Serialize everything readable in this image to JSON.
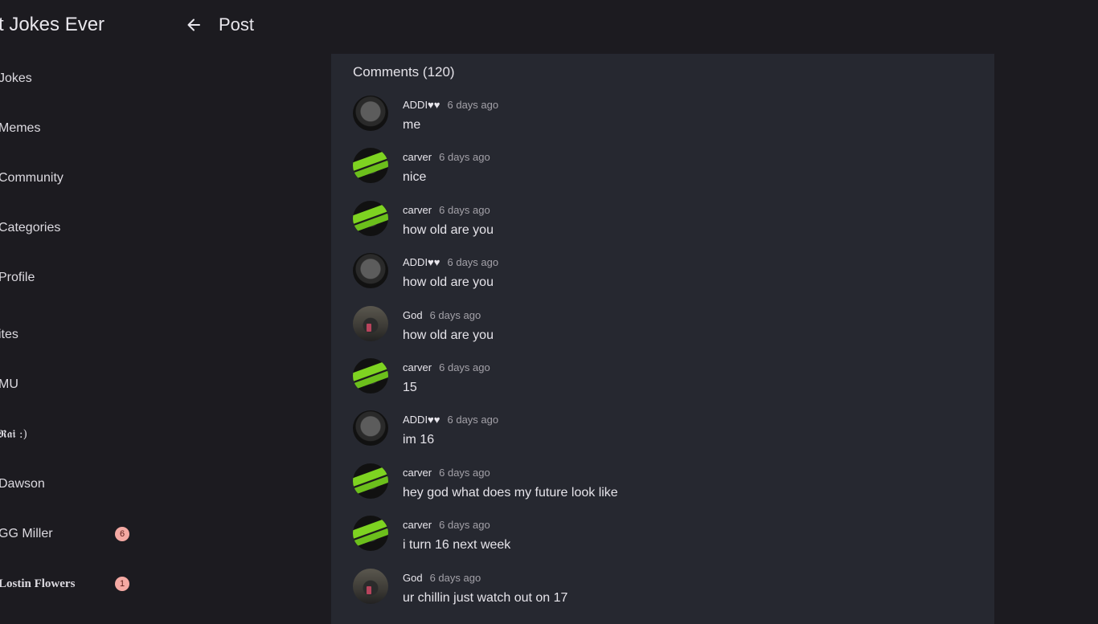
{
  "app": {
    "title": "rst Jokes Ever"
  },
  "sidebar": {
    "items": [
      {
        "label": "Jokes",
        "badge": null
      },
      {
        "label": "Memes",
        "badge": null
      },
      {
        "label": "Community",
        "badge": null
      },
      {
        "label": "Categories",
        "badge": null
      },
      {
        "label": "Profile",
        "badge": null
      },
      {
        "label": "ites",
        "badge": null
      },
      {
        "label": "MU",
        "badge": null
      },
      {
        "label": "𝕽𝖆𝖎 :)",
        "badge": null
      },
      {
        "label": "Dawson",
        "badge": null
      },
      {
        "label": "GG Miller",
        "badge": "6"
      },
      {
        "label": "Lostin Flowers",
        "badge": "1"
      }
    ]
  },
  "header": {
    "back_icon": "arrow-left-icon",
    "title": "Post"
  },
  "comments": {
    "heading": "Comments (120)",
    "list": [
      {
        "author": "ADDI♥♥",
        "time": "6 days ago",
        "text": "me",
        "avatar": "dark"
      },
      {
        "author": "carver",
        "time": "6 days ago",
        "text": "nice",
        "avatar": "green"
      },
      {
        "author": "carver",
        "time": "6 days ago",
        "text": "how old are you",
        "avatar": "green"
      },
      {
        "author": "ADDI♥♥",
        "time": "6 days ago",
        "text": "how old are you",
        "avatar": "dark"
      },
      {
        "author": "God",
        "time": "6 days ago",
        "text": "how old are you",
        "avatar": "god"
      },
      {
        "author": "carver",
        "time": "6 days ago",
        "text": "15",
        "avatar": "green"
      },
      {
        "author": "ADDI♥♥",
        "time": "6 days ago",
        "text": "im 16",
        "avatar": "dark"
      },
      {
        "author": "carver",
        "time": "6 days ago",
        "text": "hey god what does my future look like",
        "avatar": "green"
      },
      {
        "author": "carver",
        "time": "6 days ago",
        "text": "i turn 16 next week",
        "avatar": "green"
      },
      {
        "author": "God",
        "time": "6 days ago",
        "text": "ur chillin just watch out on 17",
        "avatar": "god"
      }
    ]
  },
  "colors": {
    "background": "#1c1b20",
    "card": "#262830",
    "badge": "#f4a9a3",
    "text_muted": "#a3a1a8"
  }
}
